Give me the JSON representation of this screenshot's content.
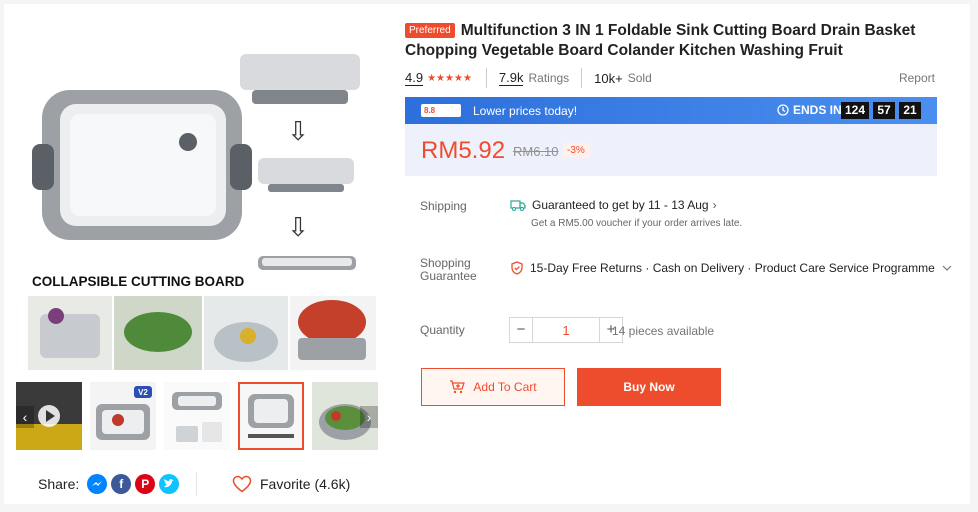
{
  "gallery": {
    "main_caption": "COLLAPSIBLE CUTTING BOARD",
    "thumb_badge": "V2",
    "prev_arrow": "‹",
    "next_arrow": "›"
  },
  "share": {
    "label": "Share:",
    "icons": [
      "messenger-icon",
      "facebook-icon",
      "pinterest-icon",
      "twitter-icon"
    ]
  },
  "favorite": {
    "label": "Favorite (4.6k)"
  },
  "product": {
    "badge": "Preferred",
    "title": "Multifunction 3 IN 1 Foldable Sink Cutting Board Drain Basket Chopping Vegetable Board Colander Kitchen Washing Fruit"
  },
  "meta": {
    "rating": "4.9",
    "stars": "★★★★★",
    "ratings_count": "7.9k",
    "ratings_label": "Ratings",
    "sold_count": "10k+",
    "sold_label": "Sold",
    "report": "Report"
  },
  "flash_sale": {
    "logo_text": "8.8",
    "tagline": "Lower prices today!",
    "ends_label": "ENDS IN",
    "hours": "124",
    "minutes": "57",
    "seconds": "2​1"
  },
  "price": {
    "current": "RM5.92",
    "original": "RM6.10",
    "discount": "-3%"
  },
  "shipping": {
    "label": "Shipping",
    "guarantee_text": "Guaranteed to get by 11 - 13 Aug",
    "voucher_text": "Get a RM5.00 voucher if your order arrives late."
  },
  "guarantee": {
    "label_line1": "Shopping",
    "label_line2": "Guarantee",
    "text": "15-Day Free Returns · Cash on Delivery · Product Care Service Programme"
  },
  "quantity": {
    "label": "Quantity",
    "minus": "−",
    "value": "1",
    "plus": "+",
    "available": "14 pieces available"
  },
  "actions": {
    "add_to_cart": "Add To Cart",
    "buy_now": "Buy Now"
  },
  "colors": {
    "accent": "#ee4d2d",
    "flash_blue": "#2d6fdb"
  }
}
